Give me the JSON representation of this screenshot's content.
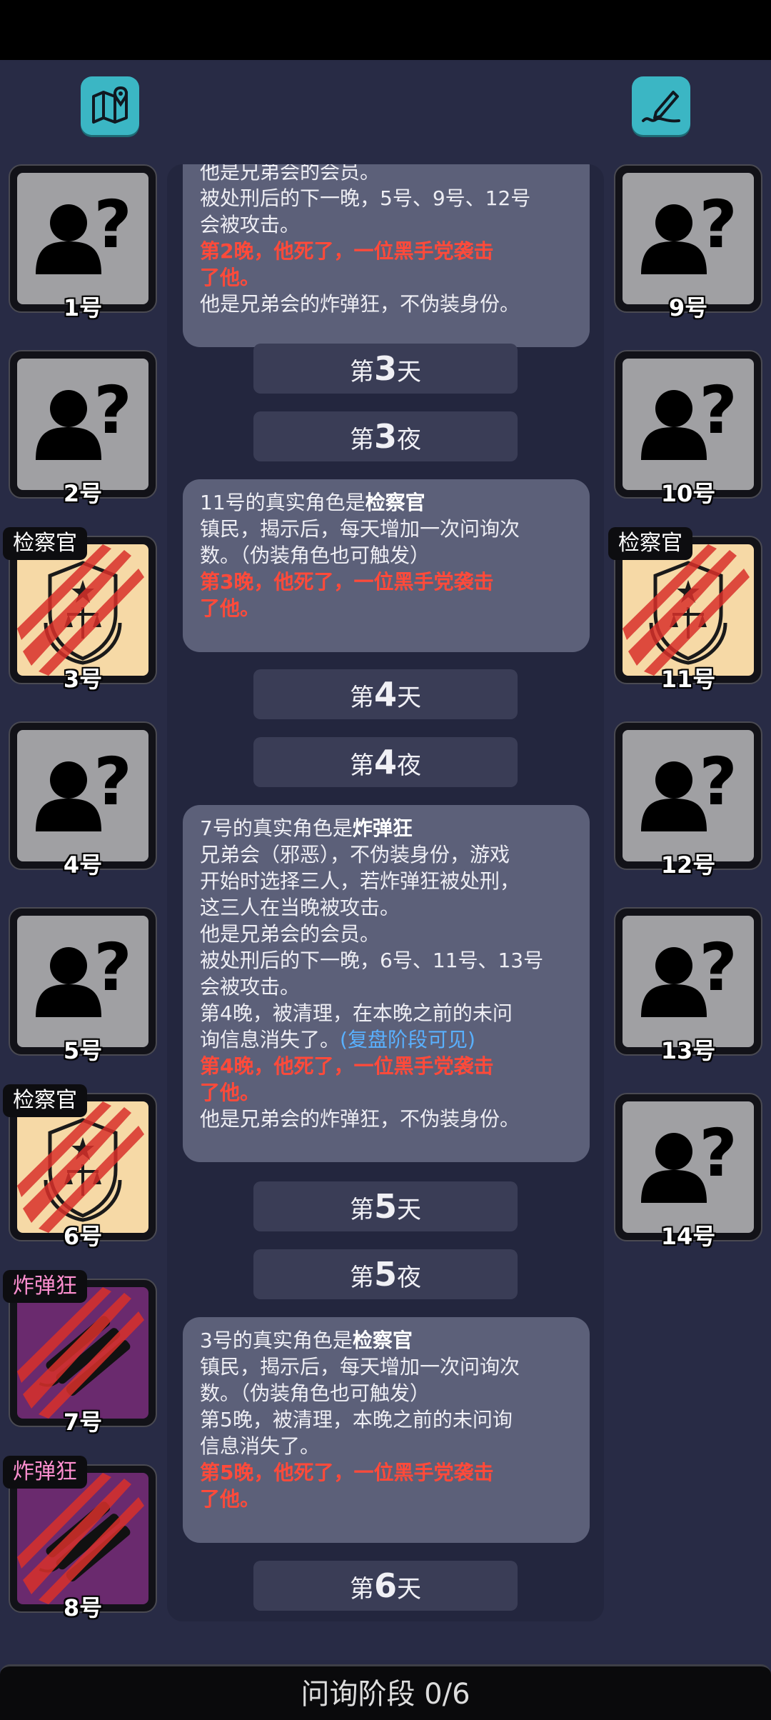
{
  "phase": {
    "label": "问询阶段 0/6"
  },
  "players": [
    {
      "num": "1号",
      "role": ""
    },
    {
      "num": "2号",
      "role": ""
    },
    {
      "num": "3号",
      "role": "检察官"
    },
    {
      "num": "4号",
      "role": ""
    },
    {
      "num": "5号",
      "role": ""
    },
    {
      "num": "6号",
      "role": "检察官"
    },
    {
      "num": "7号",
      "role": "炸弹狂"
    },
    {
      "num": "8号",
      "role": "炸弹狂"
    },
    {
      "num": "9号",
      "role": ""
    },
    {
      "num": "10号",
      "role": ""
    },
    {
      "num": "11号",
      "role": "检察官"
    },
    {
      "num": "12号",
      "role": ""
    },
    {
      "num": "13号",
      "role": ""
    },
    {
      "num": "14号",
      "role": ""
    }
  ],
  "log": {
    "b1": {
      "l0": "他是兄弟会的会员。",
      "l1": "被处刑后的下一晚，5号、9号、12号",
      "l2": "会被攻击。",
      "r1": "第2晚，他死了，一位黑手党袭击",
      "r2": "了他。",
      "l3": "他是兄弟会的炸弹狂，不伪装身份。"
    },
    "d3": {
      "pre": "第",
      "n": "3",
      "post": "天"
    },
    "n3": {
      "pre": "第",
      "n": "3",
      "post": "夜"
    },
    "b2": {
      "h_pre": "11号的真实角色是",
      "h_role": "检察官",
      "l1": "镇民，揭示后，每天增加一次问询次",
      "l2": "数。（伪装角色也可触发）",
      "r1": "第3晚，他死了，一位黑手党袭击",
      "r2": "了他。"
    },
    "d4": {
      "pre": "第",
      "n": "4",
      "post": "天"
    },
    "n4": {
      "pre": "第",
      "n": "4",
      "post": "夜"
    },
    "b3": {
      "h_pre": "7号的真实角色是",
      "h_role": "炸弹狂",
      "l1": "兄弟会（邪恶），不伪装身份，游戏",
      "l2": "开始时选择三人，若炸弹狂被处刑，",
      "l3": "这三人在当晚被攻击。",
      "l4": "他是兄弟会的会员。",
      "l5": "被处刑后的下一晚，6号、11号、13号",
      "l6": "会被攻击。",
      "l7": "第4晚，被清理，在本晚之前的未问",
      "l8": "询信息消失了。",
      "blue": "(复盘阶段可见)",
      "r1": "第4晚，他死了，一位黑手党袭击",
      "r2": "了他。",
      "l9": "他是兄弟会的炸弹狂，不伪装身份。"
    },
    "d5": {
      "pre": "第",
      "n": "5",
      "post": "天"
    },
    "n5": {
      "pre": "第",
      "n": "5",
      "post": "夜"
    },
    "b4": {
      "h_pre": "3号的真实角色是",
      "h_role": "检察官",
      "l1": "镇民，揭示后，每天增加一次问询次",
      "l2": "数。（伪装角色也可触发）",
      "l3": "第5晚，被清理，本晚之前的未问询",
      "l4": "信息消失了。",
      "r1": "第5晚，他死了，一位黑手党袭击",
      "r2": "了他。"
    },
    "d6": {
      "pre": "第",
      "n": "6",
      "post": "天"
    }
  },
  "icons": {
    "map": "map-pin-icon",
    "edit": "pen-signature-icon",
    "unknown": "unknown-person-icon",
    "inspector": "justice-emblem-icon",
    "bomber": "dynamite-icon",
    "dead": "claw-scratch-icon"
  },
  "colors": {
    "background": "#282b45",
    "bubble": "#5c6079",
    "death_text": "#ff4a3a",
    "hint_text": "#59b0ff",
    "accent": "#3bb6c4",
    "inspector_card": "#f6d9a6",
    "bomber_card": "#6a2a6e",
    "bomber_badge": "#ff8fd0"
  }
}
